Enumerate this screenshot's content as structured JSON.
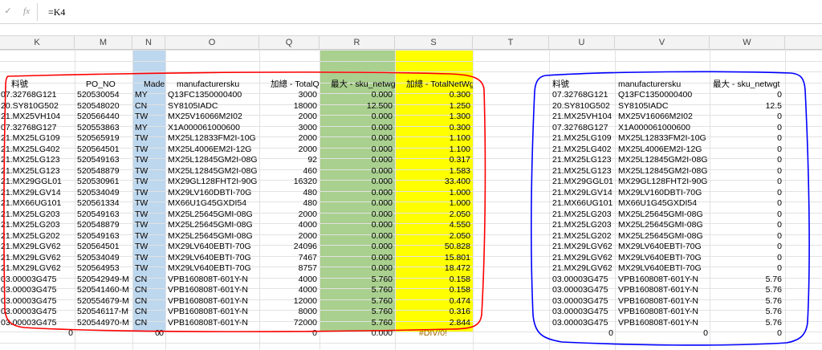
{
  "formula_bar": {
    "cancel_glyph": "✓",
    "fx_label": "fx",
    "formula": "=K4"
  },
  "columns": [
    "K",
    "M",
    "N",
    "O",
    "Q",
    "R",
    "S",
    "T",
    "U",
    "V",
    "W"
  ],
  "highlight_colors": {
    "madein": "#bdd7ee",
    "max_sku": "#a9d08e",
    "total_net": "#ffff00",
    "red_outline": "#ff0000",
    "blue_outline": "#0000ff",
    "error_text": "#9c6500"
  },
  "left_table": {
    "headers": [
      "料號",
      "PO_NO",
      "MadeIn",
      "manufacturersku",
      "加總 - TotalQty",
      "最大 - sku_netwgt",
      "加總 - TotalNetWgt"
    ],
    "rows": [
      [
        "07.32768G121",
        "520530054",
        "MY",
        "Q13FC1350000400",
        "3000",
        "0.000",
        "0.300"
      ],
      [
        "20.SY810G502",
        "520548020",
        "CN",
        "SY8105IADC",
        "18000",
        "12.500",
        "1.250"
      ],
      [
        "21.MX25VH104",
        "520566440",
        "TW",
        "MX25V16066M2I02",
        "2000",
        "0.000",
        "1.300"
      ],
      [
        "07.32768G127",
        "520553863",
        "MY",
        "X1A000061000600",
        "3000",
        "0.000",
        "0.300"
      ],
      [
        "21.MX25LG109",
        "520565919",
        "TW",
        "MX25L12833FM2I-10G",
        "2000",
        "0.000",
        "1.100"
      ],
      [
        "21.MX25LG402",
        "520564501",
        "TW",
        "MX25L4006EM2I-12G",
        "2000",
        "0.000",
        "1.100"
      ],
      [
        "21.MX25LG123",
        "520549163",
        "TW",
        "MX25L12845GM2I-08G",
        "92",
        "0.000",
        "0.317"
      ],
      [
        "21.MX25LG123",
        "520548879",
        "TW",
        "MX25L12845GM2I-08G",
        "460",
        "0.000",
        "1.583"
      ],
      [
        "21.MX29GGL01",
        "520530961",
        "TW",
        "MX29GL128FHT2I-90G",
        "16320",
        "0.000",
        "33.400"
      ],
      [
        "21.MX29LGV14",
        "520534049",
        "TW",
        "MX29LV160DBTI-70G",
        "480",
        "0.000",
        "1.000"
      ],
      [
        "21.MX66UG101",
        "520561334",
        "TW",
        "MX66U1G45GXDI54",
        "480",
        "0.000",
        "1.000"
      ],
      [
        "21.MX25LG203",
        "520549163",
        "TW",
        "MX25L25645GMI-08G",
        "2000",
        "0.000",
        "2.050"
      ],
      [
        "21.MX25LG203",
        "520548879",
        "TW",
        "MX25L25645GMI-08G",
        "4000",
        "0.000",
        "4.550"
      ],
      [
        "21.MX25LG202",
        "520549163",
        "TW",
        "MX25L25645GMI-08G",
        "2000",
        "0.000",
        "2.050"
      ],
      [
        "21.MX29LGV62",
        "520564501",
        "TW",
        "MX29LV640EBTI-70G",
        "24096",
        "0.000",
        "50.828"
      ],
      [
        "21.MX29LGV62",
        "520534049",
        "TW",
        "MX29LV640EBTI-70G",
        "7467",
        "0.000",
        "15.801"
      ],
      [
        "21.MX29LGV62",
        "520564953",
        "TW",
        "MX29LV640EBTI-70G",
        "8757",
        "0.000",
        "18.472"
      ],
      [
        "03.00003G475",
        "520542949-M",
        "CN",
        "VPB160808T-601Y-N",
        "4000",
        "5.760",
        "0.158"
      ],
      [
        "03.00003G475",
        "520541460-M",
        "CN",
        "VPB160808T-601Y-N",
        "4000",
        "5.760",
        "0.158"
      ],
      [
        "03.00003G475",
        "520554679-M",
        "CN",
        "VPB160808T-601Y-N",
        "12000",
        "5.760",
        "0.474"
      ],
      [
        "03.00003G475",
        "520546117-M",
        "CN",
        "VPB160808T-601Y-N",
        "8000",
        "5.760",
        "0.316"
      ],
      [
        "03.00003G475",
        "520544970-M",
        "CN",
        "VPB160808T-601Y-N",
        "72000",
        "5.760",
        "2.844"
      ]
    ],
    "totals": {
      "k": "0",
      "madein": "0",
      "po": "0",
      "qty": "0",
      "netwgt": "0.000",
      "total": "#DIV/0!"
    }
  },
  "right_table": {
    "headers": [
      "料號",
      "manufacturersku",
      "最大 - sku_netwgt"
    ],
    "rows": [
      [
        "07.32768G121",
        "Q13FC1350000400",
        "0"
      ],
      [
        "20.SY810G502",
        "SY8105IADC",
        "12.5"
      ],
      [
        "21.MX25VH104",
        "MX25V16066M2I02",
        "0"
      ],
      [
        "07.32768G127",
        "X1A000061000600",
        "0"
      ],
      [
        "21.MX25LG109",
        "MX25L12833FM2I-10G",
        "0"
      ],
      [
        "21.MX25LG402",
        "MX25L4006EM2I-12G",
        "0"
      ],
      [
        "21.MX25LG123",
        "MX25L12845GM2I-08G",
        "0"
      ],
      [
        "21.MX25LG123",
        "MX25L12845GM2I-08G",
        "0"
      ],
      [
        "21.MX29GGL01",
        "MX29GL128FHT2I-90G",
        "0"
      ],
      [
        "21.MX29LGV14",
        "MX29LV160DBTI-70G",
        "0"
      ],
      [
        "21.MX66UG101",
        "MX66U1G45GXDI54",
        "0"
      ],
      [
        "21.MX25LG203",
        "MX25L25645GMI-08G",
        "0"
      ],
      [
        "21.MX25LG203",
        "MX25L25645GMI-08G",
        "0"
      ],
      [
        "21.MX25LG202",
        "MX25L25645GMI-08G",
        "0"
      ],
      [
        "21.MX29LGV62",
        "MX29LV640EBTI-70G",
        "0"
      ],
      [
        "21.MX29LGV62",
        "MX29LV640EBTI-70G",
        "0"
      ],
      [
        "21.MX29LGV62",
        "MX29LV640EBTI-70G",
        "0"
      ],
      [
        "03.00003G475",
        "VPB160808T-601Y-N",
        "5.76"
      ],
      [
        "03.00003G475",
        "VPB160808T-601Y-N",
        "5.76"
      ],
      [
        "03.00003G475",
        "VPB160808T-601Y-N",
        "5.76"
      ],
      [
        "03.00003G475",
        "VPB160808T-601Y-N",
        "5.76"
      ],
      [
        "03.00003G475",
        "VPB160808T-601Y-N",
        "5.76"
      ]
    ],
    "totals": {
      "k": "0",
      "sku": "0",
      "max": "0"
    }
  }
}
